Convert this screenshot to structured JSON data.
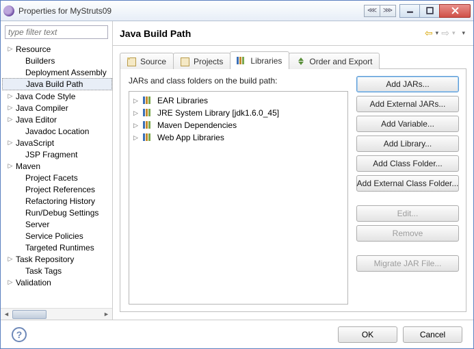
{
  "window": {
    "title": "Properties for MyStruts09"
  },
  "filter": {
    "placeholder": "type filter text"
  },
  "tree": {
    "items": [
      {
        "label": "Resource",
        "expandable": true,
        "indent": false
      },
      {
        "label": "Builders",
        "expandable": false,
        "indent": true
      },
      {
        "label": "Deployment Assembly",
        "expandable": false,
        "indent": true
      },
      {
        "label": "Java Build Path",
        "expandable": false,
        "indent": true,
        "selected": true
      },
      {
        "label": "Java Code Style",
        "expandable": true,
        "indent": false
      },
      {
        "label": "Java Compiler",
        "expandable": true,
        "indent": false
      },
      {
        "label": "Java Editor",
        "expandable": true,
        "indent": false
      },
      {
        "label": "Javadoc Location",
        "expandable": false,
        "indent": true
      },
      {
        "label": "JavaScript",
        "expandable": true,
        "indent": false
      },
      {
        "label": "JSP Fragment",
        "expandable": false,
        "indent": true
      },
      {
        "label": "Maven",
        "expandable": true,
        "indent": false
      },
      {
        "label": "Project Facets",
        "expandable": false,
        "indent": true
      },
      {
        "label": "Project References",
        "expandable": false,
        "indent": true
      },
      {
        "label": "Refactoring History",
        "expandable": false,
        "indent": true
      },
      {
        "label": "Run/Debug Settings",
        "expandable": false,
        "indent": true
      },
      {
        "label": "Server",
        "expandable": false,
        "indent": true
      },
      {
        "label": "Service Policies",
        "expandable": false,
        "indent": true
      },
      {
        "label": "Targeted Runtimes",
        "expandable": false,
        "indent": true
      },
      {
        "label": "Task Repository",
        "expandable": true,
        "indent": false
      },
      {
        "label": "Task Tags",
        "expandable": false,
        "indent": true
      },
      {
        "label": "Validation",
        "expandable": true,
        "indent": false
      }
    ]
  },
  "header": {
    "title": "Java Build Path"
  },
  "tabs": {
    "source": "Source",
    "projects": "Projects",
    "libraries": "Libraries",
    "order": "Order and Export"
  },
  "libs": {
    "caption": "JARs and class folders on the build path:",
    "items": [
      "EAR Libraries",
      "JRE System Library [jdk1.6.0_45]",
      "Maven Dependencies",
      "Web App Libraries"
    ]
  },
  "buttons": {
    "add_jars": "Add JARs...",
    "add_ext_jars": "Add External JARs...",
    "add_var": "Add Variable...",
    "add_lib": "Add Library...",
    "add_class": "Add Class Folder...",
    "add_ext_class": "Add External Class Folder...",
    "edit": "Edit...",
    "remove": "Remove",
    "migrate": "Migrate JAR File..."
  },
  "footer": {
    "ok": "OK",
    "cancel": "Cancel"
  }
}
